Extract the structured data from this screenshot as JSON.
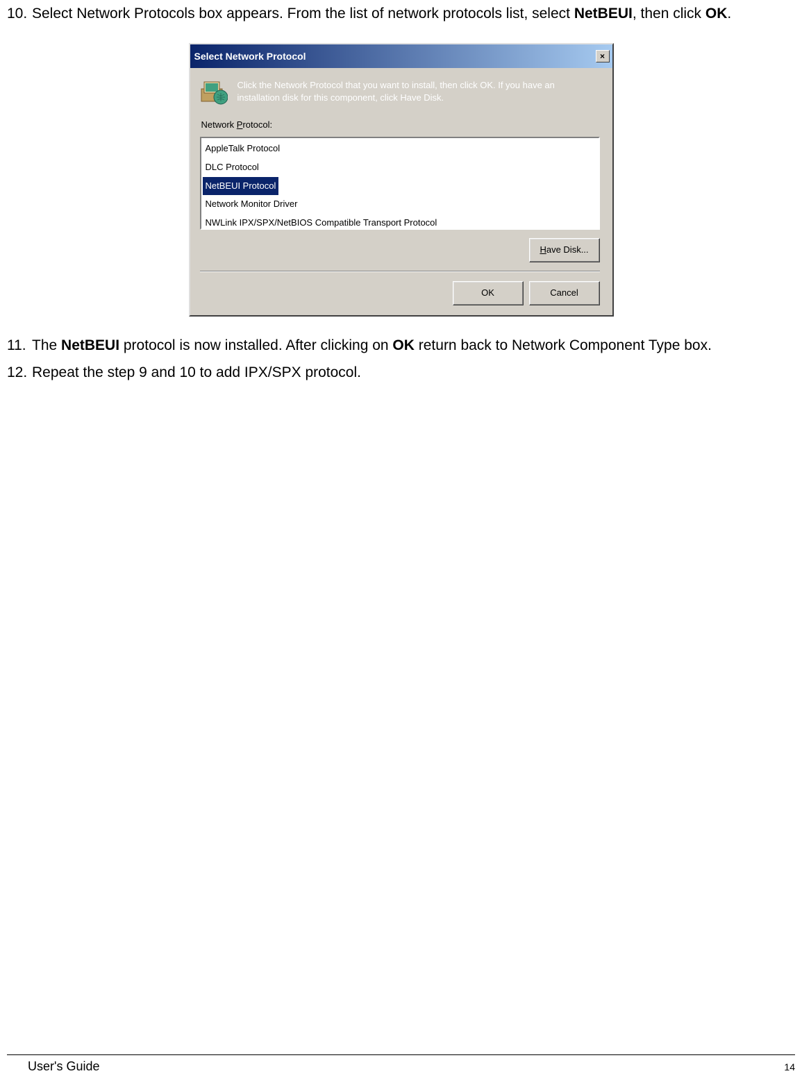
{
  "steps": {
    "s10": {
      "num": "10.",
      "part1": "Select Network Protocols box appears.  From the list of network protocols list, select ",
      "bold1": "NetBEUI",
      "part2": ", then click ",
      "bold2": "OK",
      "part3": "."
    },
    "s11": {
      "num": "11.",
      "part1": "The ",
      "bold1": "NetBEUI",
      "part2": " protocol is now installed. After clicking on ",
      "bold2": "OK",
      "part3": " return back to Network Component Type box."
    },
    "s12": {
      "num": "12.",
      "text": "Repeat the step 9 and 10 to add IPX/SPX protocol."
    }
  },
  "dialog": {
    "title": "Select Network Protocol",
    "close": "×",
    "info": "Click the Network Protocol that you want to install, then click OK. If you have an installation disk for this component, click Have Disk.",
    "listLabelPrefix": "Network ",
    "listLabelUnderline": "P",
    "listLabelSuffix": "rotocol:",
    "items": [
      "AppleTalk Protocol",
      "DLC Protocol",
      "NetBEUI Protocol",
      "Network Monitor Driver",
      "NWLink IPX/SPX/NetBIOS Compatible Transport Protocol"
    ],
    "haveDiskUnderline": "H",
    "haveDiskRest": "ave Disk...",
    "ok": "OK",
    "cancel": "Cancel"
  },
  "footer": {
    "left": "User's Guide",
    "right": "14"
  }
}
